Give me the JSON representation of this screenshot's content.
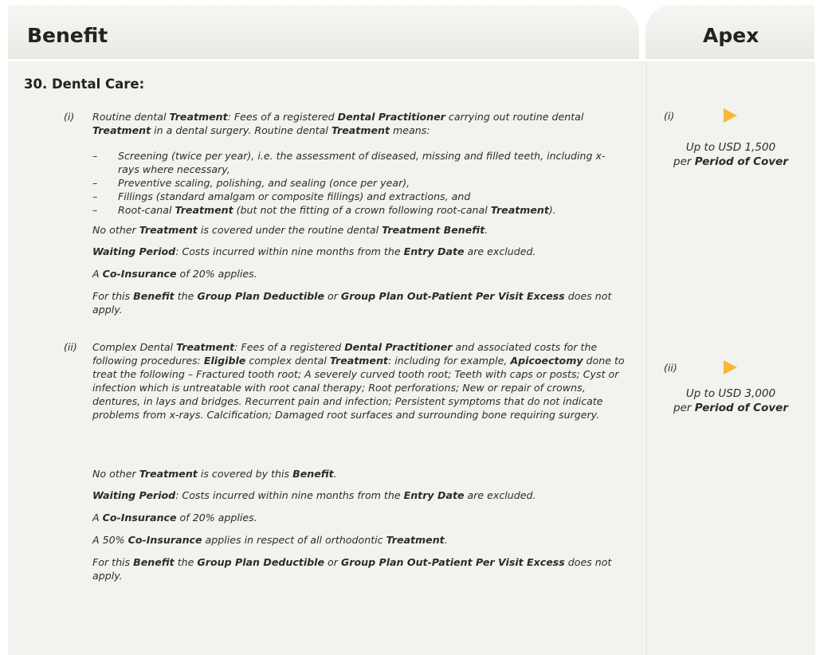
{
  "header": {
    "benefit": "Benefit",
    "apex": "Apex"
  },
  "section_title": "30.  Dental Care:",
  "items": [
    {
      "num": "(i)",
      "intro": [
        "Routine dental ",
        "Treatment",
        ": Fees of a registered ",
        "Dental Practitioner",
        " carrying out routine dental ",
        "Treatment",
        " in a dental surgery. Routine dental ",
        "Treatment",
        " means:"
      ],
      "bullets": [
        "Screening (twice per year), i.e. the assessment of diseased, missing and filled teeth, including x-rays where necessary,",
        "Preventive scaling, polishing, and sealing (once per year),",
        "Fillings (standard amalgam or composite fillings) and extractions, and",
        [
          "Root-canal ",
          "Treatment",
          " (but not the fitting of a crown following root-canal ",
          "Treatment",
          ")."
        ]
      ],
      "dash": "–",
      "no_other": [
        "No other ",
        "Treatment",
        " is covered under the routine dental ",
        "Treatment Benefit",
        "."
      ],
      "waiting": [
        "Waiting Period",
        ": Costs incurred within nine months from the ",
        "Entry Date",
        " are excluded."
      ],
      "coins": [
        "A ",
        "Co-Insurance",
        " of 20% applies."
      ],
      "deductible": [
        "For this ",
        "Benefit",
        " the ",
        "Group Plan Deductible",
        " or ",
        "Group Plan Out-Patient Per Visit Excess",
        " does not apply."
      ]
    },
    {
      "num": "(ii)",
      "intro": [
        "Complex Dental ",
        "Treatment",
        ": Fees of a registered ",
        "Dental Practitioner",
        " and associated costs for the following procedures: ",
        "Eligible",
        " complex dental ",
        "Treatment",
        ": including for example, ",
        "Apicoectomy",
        " done to treat the following – Fractured tooth root; A severely curved tooth root; Teeth with caps or posts; Cyst or infection which is untreatable with root canal therapy; Root perforations; New or repair of crowns, dentures, in lays and bridges. Recurrent pain and infection; Persistent symptoms that do not indicate problems from x-rays. Calcification; Damaged root surfaces and surrounding bone requiring surgery."
      ],
      "no_other": [
        "No other ",
        "Treatment",
        " is covered by this ",
        "Benefit",
        "."
      ],
      "waiting": [
        "Waiting Period",
        ": Costs incurred within nine months from the ",
        "Entry Date",
        " are excluded."
      ],
      "coins": [
        "A ",
        "Co-Insurance",
        " of 20% applies."
      ],
      "ortho": [
        "A 50% ",
        "Co-Insurance",
        " applies in respect of all orthodontic ",
        "Treatment",
        "."
      ],
      "deductible": [
        "For this ",
        "Benefit",
        " the ",
        "Group Plan Deductible",
        " or ",
        "Group Plan Out-Patient Per Visit Excess",
        " does not apply."
      ]
    }
  ],
  "apex": [
    {
      "num": "(i)",
      "line1": "Up to USD 1,500",
      "line2_pre": "per ",
      "line2_bold": "Period of Cover"
    },
    {
      "num": "(ii)",
      "line1": "Up to USD 3,000",
      "line2_pre": "per ",
      "line2_bold": "Period of Cover"
    }
  ],
  "colors": {
    "header_bg": "#eeeeea",
    "body_bg": "#f2f2ee",
    "arrow": "#f6b838"
  }
}
